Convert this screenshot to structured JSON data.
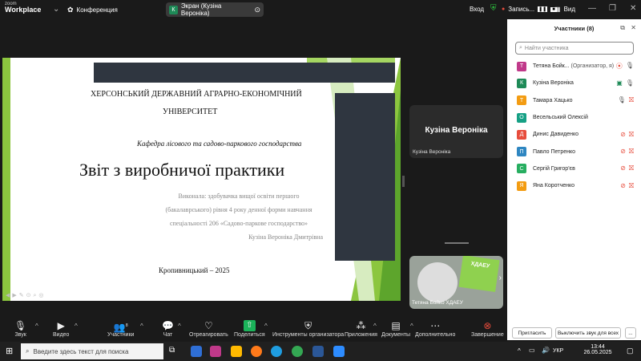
{
  "topbar": {
    "logo_small": "zoom",
    "logo_big": "Workplace",
    "meeting": "Конференция",
    "share_avatar": "К",
    "share_label": "Экран (Кузіна Вероніка)",
    "login": "Вход",
    "record": "Запись...",
    "view": "Вид"
  },
  "slide": {
    "line1": "ХЕРСОНСЬКИЙ ДЕРЖАВНИЙ АГРАРНО-ЕКОНОМІЧНИЙ",
    "line2": "УНІВЕРСИТЕТ",
    "dept": "Кафедра лісового та садово-паркового господарства",
    "title": "Звіт з виробничої практики",
    "g1": "Виконала: здобувачка вищої освіти першого",
    "g2": "(бакалаврського) рівня 4 року денної форми навчання",
    "g3": "спеціальності 206 «Садово-паркове господарство»",
    "g4": "Кузіна Вероніка Дмитрівна",
    "city": "Кропивницький – 2025"
  },
  "tiles": {
    "t1_big": "Кузіна Вероніка",
    "t1_label": "Кузіна Вероніка",
    "t2_label": "Тетяна Бойко ХДАЕУ"
  },
  "panel": {
    "title": "Участники (8)",
    "search_placeholder": "Найти участника",
    "participants": [
      {
        "initial": "Т",
        "name": "Тетяна Бойк...",
        "role": "(Организатор, я)",
        "color": "#c0398a"
      },
      {
        "initial": "К",
        "name": "Кузіна Вероніка",
        "role": "",
        "color": "#1e8a57"
      },
      {
        "initial": "Т",
        "name": "Тамара Хацько",
        "role": "",
        "color": "#f39c12"
      },
      {
        "initial": "О",
        "name": "Весельський Олексій",
        "role": "",
        "color": "#16a085"
      },
      {
        "initial": "Д",
        "name": "Динис Давиденко",
        "role": "",
        "color": "#e74c3c"
      },
      {
        "initial": "П",
        "name": "Павло Петренко",
        "role": "",
        "color": "#2e86c1"
      },
      {
        "initial": "С",
        "name": "Сергій Григор'єв",
        "role": "",
        "color": "#27ae60"
      },
      {
        "initial": "Я",
        "name": "Яна Коротченко",
        "role": "",
        "color": "#f39c12"
      }
    ],
    "invite": "Пригласить",
    "mute_all": "Выключить звук для всех",
    "more": "..."
  },
  "controls": {
    "audio": "Звук",
    "video": "Видео",
    "participants": "Участники",
    "participants_count": "8",
    "chat": "Чат",
    "react": "Отреагировать",
    "share": "Поделиться",
    "host_tools": "Инструменты организатора",
    "apps": "Приложения",
    "docs": "Документы",
    "more": "Дополнительно",
    "end": "Завершение"
  },
  "taskbar": {
    "search": "Введите здесь текст для поиска",
    "lang": "УКР",
    "time": "13:44",
    "date": "26.05.2025"
  }
}
